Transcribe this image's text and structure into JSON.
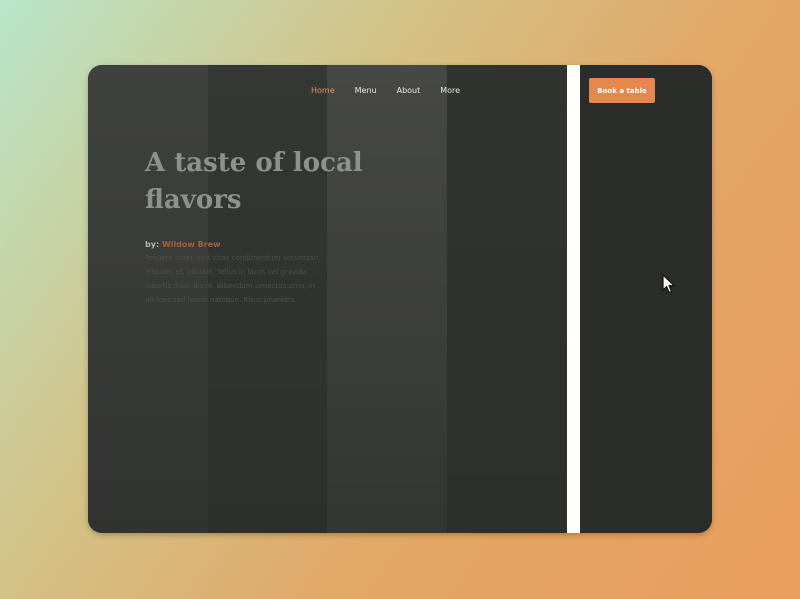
{
  "nav": {
    "items": [
      {
        "label": "Home",
        "active": true
      },
      {
        "label": "Menu",
        "active": false
      },
      {
        "label": "About",
        "active": false
      },
      {
        "label": "More",
        "active": false
      }
    ]
  },
  "cta": {
    "label": "Book a table"
  },
  "hero": {
    "title": "A taste of local flavors",
    "by_prefix": "by:",
    "author": "Wildow Brew",
    "body": "Posuere amet, sed vitae condimentum accumsan aliquam et, bibliam. Tellus in lacus vel gravida lobortis diam dis ut. Bibendum senectus urna, in ultrices sed lorem natoque. Risus pharetra."
  },
  "colors": {
    "accent": "#e3894f",
    "window_bg": "#2b2d2a",
    "divider": "#ffffff"
  },
  "icons": {
    "cursor": "mouse-pointer-icon"
  }
}
